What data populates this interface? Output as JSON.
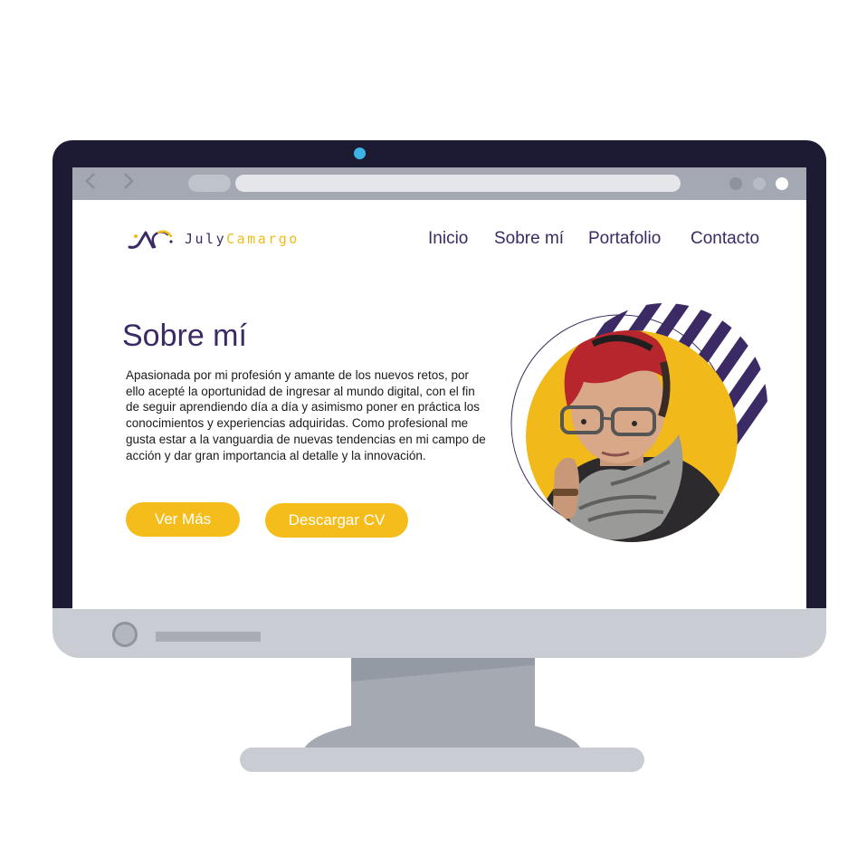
{
  "brand": {
    "name_first": "July",
    "name_second": "Camargo"
  },
  "nav": {
    "items": [
      "Inicio",
      "Sobre mí",
      "Portafolio",
      "Contacto"
    ]
  },
  "about": {
    "title": "Sobre mí",
    "paragraph": "Apasionada por mi profesión y amante de los nuevos retos, por ello acepté la oportunidad de ingresar al mundo digital, con el fin de seguir aprendiendo día a día y asimismo poner en práctica los conocimientos y experiencias adquiridas. Como profesional me gusta estar a la vanguardia de nuevas tendencias en mi campo de acción y dar gran importancia al detalle y la innovación."
  },
  "buttons": {
    "more": "Ver Más",
    "cv": "Descargar CV"
  },
  "browser": {
    "back_icon": "chevron-left-icon",
    "forward_icon": "chevron-right-icon"
  },
  "colors": {
    "primary": "#3b2a63",
    "accent": "#f5bd1c",
    "bezel": "#1c1b33",
    "camera": "#3cb3e6"
  }
}
